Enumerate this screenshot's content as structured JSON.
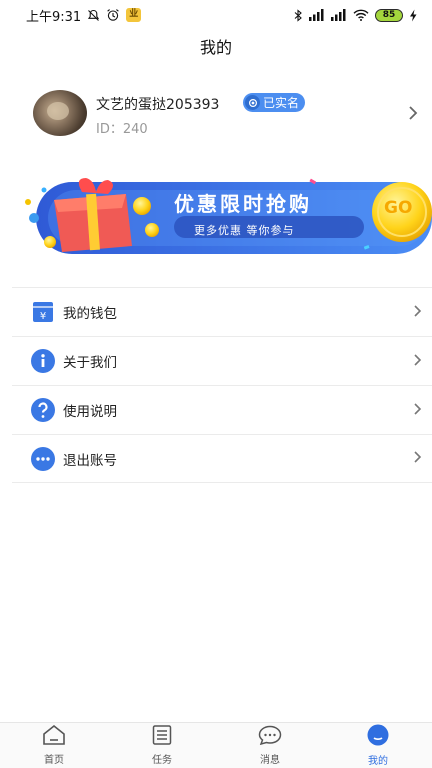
{
  "status_bar": {
    "time": "上午9:31",
    "badge": "业",
    "battery": "85"
  },
  "header": {
    "title": "我的"
  },
  "profile": {
    "name": "文艺的蛋挞205393",
    "verified_label": "已实名",
    "id_label": "ID：240"
  },
  "banner": {
    "title": "优惠限时抢购",
    "subtitle": "更多优惠  等你参与",
    "go_label": "GO"
  },
  "menu": {
    "items": [
      {
        "label": "我的钱包",
        "icon": "wallet-icon"
      },
      {
        "label": "关于我们",
        "icon": "info-icon"
      },
      {
        "label": "使用说明",
        "icon": "help-icon"
      },
      {
        "label": "退出账号",
        "icon": "more-icon"
      }
    ]
  },
  "tab_bar": {
    "tabs": [
      {
        "label": "首页",
        "icon": "home-icon"
      },
      {
        "label": "任务",
        "icon": "list-icon"
      },
      {
        "label": "消息",
        "icon": "message-icon"
      },
      {
        "label": "我的",
        "icon": "profile-icon"
      }
    ],
    "active_index": 3
  },
  "colors": {
    "accent": "#2f6ee0",
    "icon_blue": "#3a78e4",
    "text": "#222222",
    "muted": "#999999",
    "divider": "#ebebeb"
  }
}
